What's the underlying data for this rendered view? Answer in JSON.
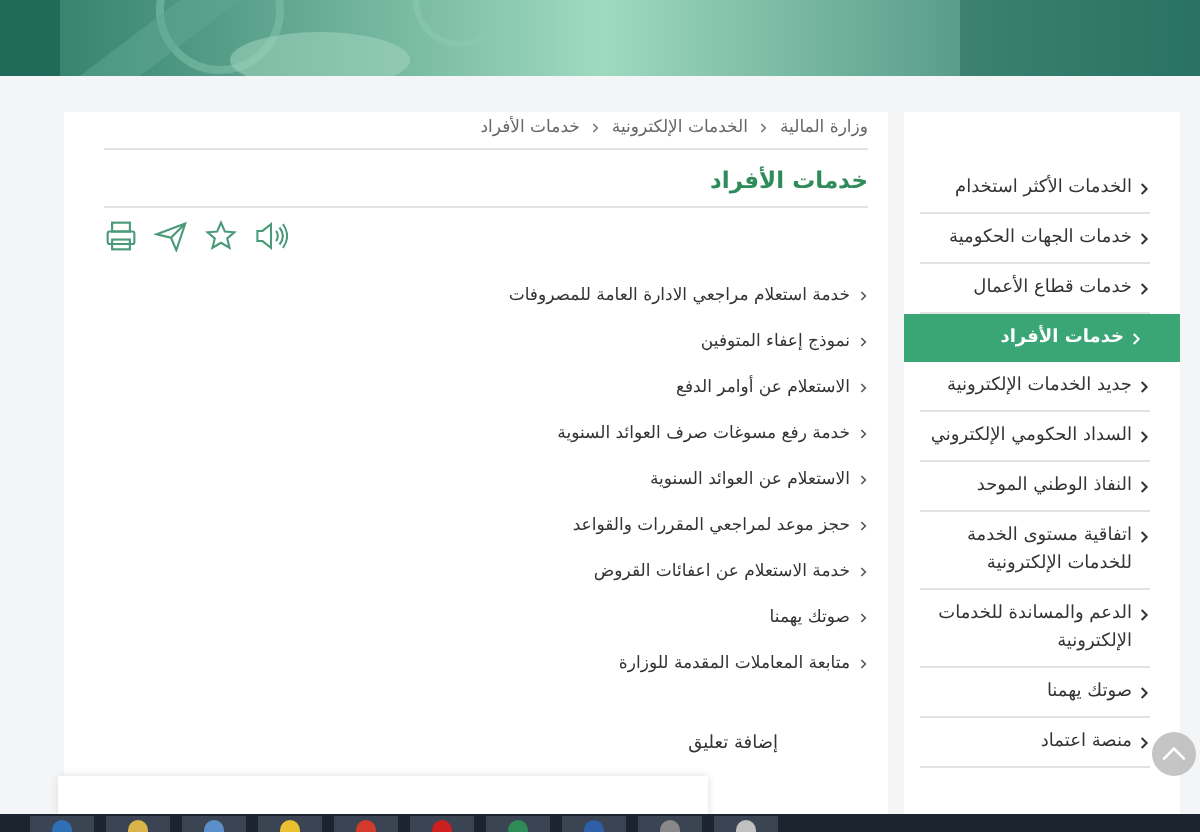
{
  "breadcrumb": [
    "وزارة المالية",
    "الخدمات الإلكترونية",
    "خدمات الأفراد"
  ],
  "page_title": "خدمات الأفراد",
  "services": [
    "خدمة استعلام مراجعي الادارة العامة للمصروفات",
    "نموذج إعفاء المتوفين",
    "الاستعلام عن أوامر الدفع",
    "خدمة رفع مسوغات صرف العوائد السنوية",
    "الاستعلام عن العوائد السنوية",
    "حجز موعد لمراجعي المقررات والقواعد",
    "خدمة الاستعلام عن اعفائات القروض",
    "صوتك يهمنا",
    "متابعة المعاملات المقدمة للوزارة"
  ],
  "comment_heading": "إضافة تعليق",
  "sidebar": {
    "items": [
      {
        "label": "الخدمات الأكثر استخدام",
        "selected": false
      },
      {
        "label": "خدمات الجهات الحكومية",
        "selected": false
      },
      {
        "label": "خدمات قطاع الأعمال",
        "selected": false
      },
      {
        "label": "خدمات الأفراد",
        "selected": true
      },
      {
        "label": "جديد الخدمات الإلكترونية",
        "selected": false
      },
      {
        "label": "السداد الحكومي الإلكتروني",
        "selected": false
      },
      {
        "label": "النفاذ الوطني الموحد",
        "selected": false
      },
      {
        "label": "اتفاقية مستوى الخدمة للخدمات الإلكترونية",
        "selected": false
      },
      {
        "label": "الدعم والمساندة للخدمات الإلكترونية",
        "selected": false
      },
      {
        "label": "صوتك يهمنا",
        "selected": false
      },
      {
        "label": "منصة اعتماد",
        "selected": false
      }
    ]
  }
}
